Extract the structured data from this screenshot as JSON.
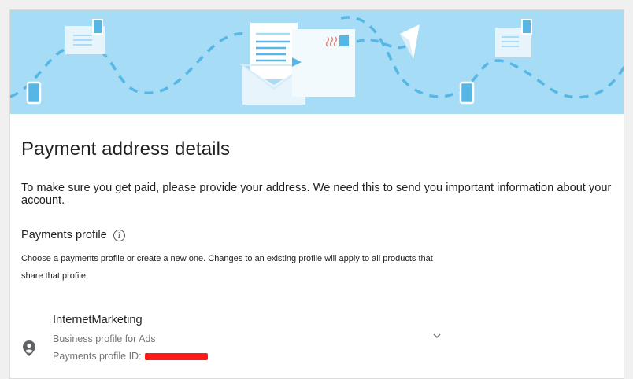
{
  "page": {
    "title": "Payment address details",
    "intro": "To make sure you get paid, please provide your address. We need this to send you important information about your account."
  },
  "payments_profile": {
    "heading": "Payments profile",
    "info_icon": "info-icon",
    "description": "Choose a payments profile or create a new one. Changes to an existing profile will apply to all products that share that profile.",
    "selected": {
      "name": "InternetMarketing",
      "type": "Business profile for Ads",
      "id_label": "Payments profile ID:",
      "id_value_redacted": true,
      "avatar_icon": "person-icon",
      "expand_icon": "chevron-down-icon"
    }
  },
  "colors": {
    "banner_bg": "#a6dcf5",
    "banner_accent": "#56b7e6",
    "redaction": "#ff1a1a"
  }
}
